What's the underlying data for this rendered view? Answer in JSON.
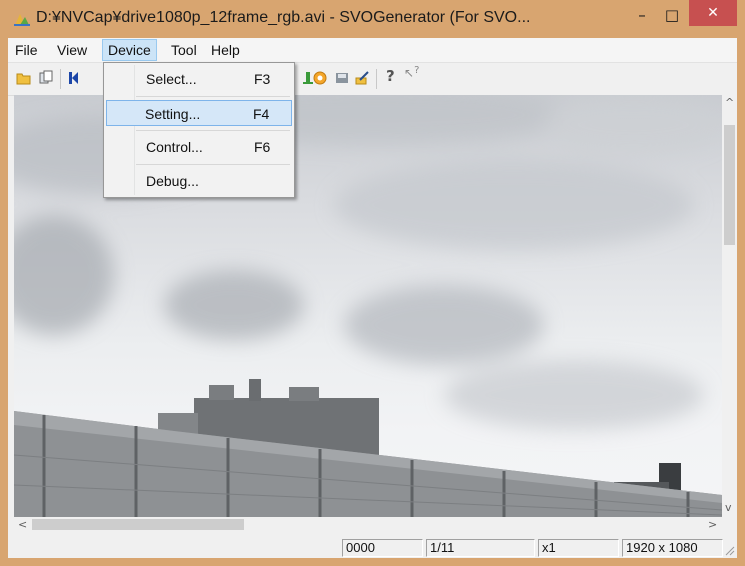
{
  "window": {
    "title": "D:¥NVCap¥drive1080p_12frame_rgb.avi - SVOGenerator (For SVO...",
    "minimize_glyph": "–",
    "maximize_glyph": "□",
    "close_glyph": "✕"
  },
  "menubar": {
    "items": [
      {
        "label": "File"
      },
      {
        "label": "View"
      },
      {
        "label": "Device"
      },
      {
        "label": "Tool"
      },
      {
        "label": "Help"
      }
    ]
  },
  "device_menu": {
    "items": [
      {
        "label": "Select...",
        "shortcut": "F3"
      },
      {
        "label": "Setting...",
        "shortcut": "F4"
      },
      {
        "label": "Control...",
        "shortcut": "F6"
      },
      {
        "label": "Debug...",
        "shortcut": ""
      }
    ]
  },
  "toolbar": {
    "icons": [
      "open-folder-icon",
      "copy-icon",
      "skip-back-icon",
      "record-icon",
      "gear-icon",
      "disk-icon",
      "edit-icon",
      "help-icon",
      "context-help-icon"
    ],
    "help_glyph": "?",
    "context_help_glyph": "?"
  },
  "scrollbars": {
    "up": "^",
    "down": "v",
    "left": "<",
    "right": ">"
  },
  "statusbar": {
    "frame_code": "0000",
    "frame_index": "1/11",
    "zoom": "x1",
    "resolution": "1920 x 1080"
  },
  "colors": {
    "title_bar": "#d8a570",
    "close_button": "#c75050",
    "menu_highlight": "#cce4f7",
    "menu_item_hot": "#d5e7f8"
  }
}
